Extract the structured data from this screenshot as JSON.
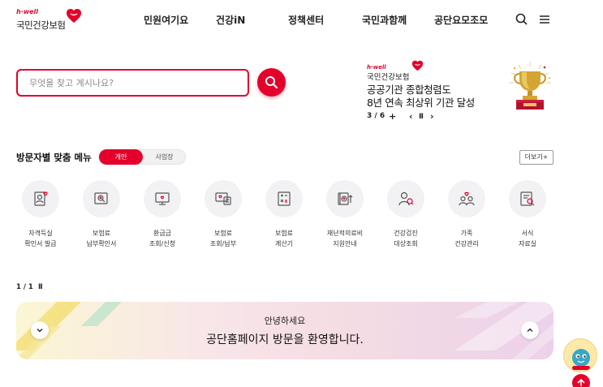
{
  "header": {
    "logo": {
      "tagline": "h·well",
      "name": "국민건강보험"
    },
    "nav": [
      "민원여기요",
      "건강iN",
      "정책센터",
      "국민과함께",
      "공단요모조모"
    ],
    "icons": {
      "search": "search-icon",
      "menu": "hamburger-menu-icon"
    }
  },
  "search": {
    "placeholder": "무엇을 찾고 계시나요?",
    "value": ""
  },
  "banner": {
    "tagline": "h·well",
    "org": "국민건강보험",
    "title_line1": "공공기관 종합청렴도",
    "title_line2": "8년 연속 최상위 기관 달성",
    "pager": "3 / 6",
    "controls": {
      "add": "+",
      "prev": "‹",
      "pause": "Ⅱ",
      "next": "›"
    }
  },
  "visitor_menu": {
    "title": "방문자별 맞춤 메뉴",
    "toggle": {
      "personal": "개인",
      "business": "사업장",
      "active": "personal"
    },
    "more_label": "더보기+",
    "items": [
      {
        "line1": "자격득실",
        "line2": "확인서 발급",
        "icon": "qualification-certificate-icon"
      },
      {
        "line1": "보험료",
        "line2": "납부확인서",
        "icon": "premium-payment-confirmation-icon"
      },
      {
        "line1": "환급금",
        "line2": "조회/신청",
        "icon": "refund-monitor-icon"
      },
      {
        "line1": "보험료",
        "line2": "조회/납부",
        "icon": "premium-inquiry-icon"
      },
      {
        "line1": "보험료",
        "line2": "계산기",
        "icon": "calculator-icon"
      },
      {
        "line1": "재난적의료비",
        "line2": "지원안내",
        "icon": "medical-expense-support-icon"
      },
      {
        "line1": "건강검진",
        "line2": "대상조회",
        "icon": "checkup-target-icon"
      },
      {
        "line1": "가족",
        "line2": "건강관리",
        "icon": "family-health-icon"
      },
      {
        "line1": "서식",
        "line2": "자료실",
        "icon": "forms-archive-icon"
      }
    ],
    "pager": "1 / 1",
    "pause": "Ⅱ"
  },
  "welcome": {
    "greeting": "안녕하세요",
    "message": "공단홈페이지 방문을 환영합니다."
  },
  "colors": {
    "accent": "#e4002b",
    "icon_bg": "#f2f2f4",
    "text": "#222222"
  }
}
